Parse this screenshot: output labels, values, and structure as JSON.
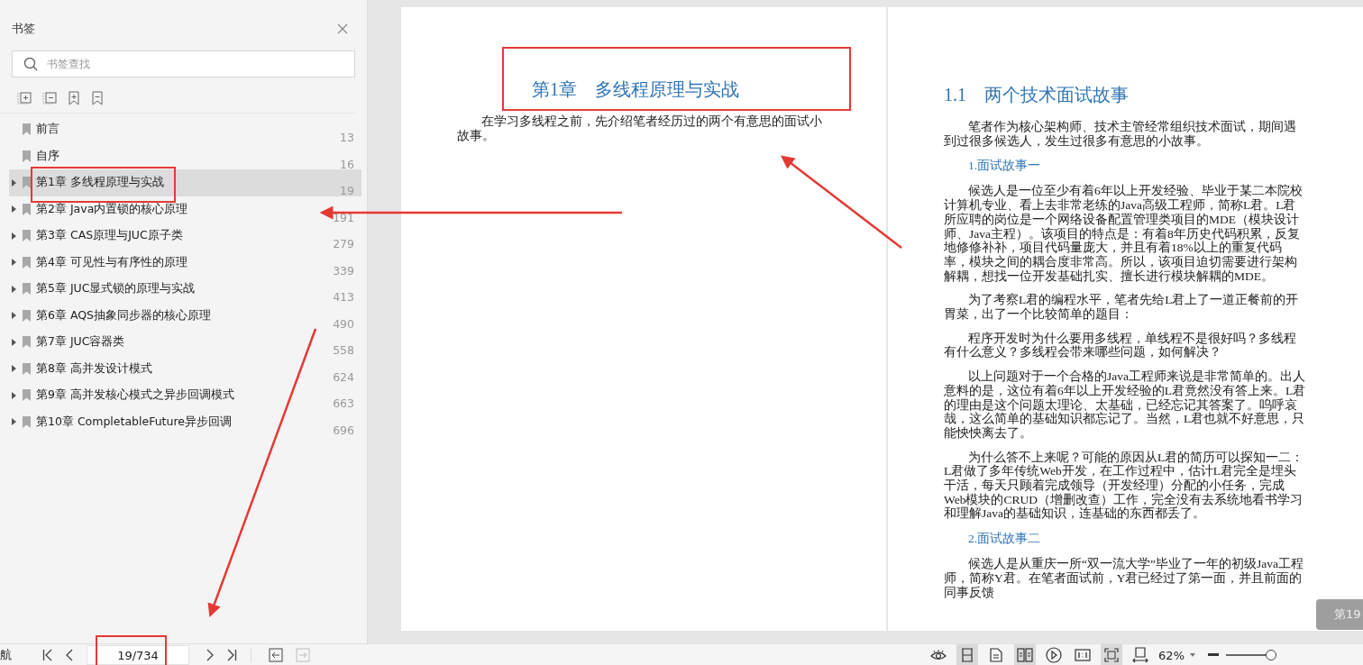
{
  "sidebar": {
    "title": "书签",
    "search": {
      "placeholder": "书签查找"
    },
    "items": [
      {
        "label": "前言",
        "page": "13",
        "collapsible": false,
        "selected": false
      },
      {
        "label": "自序",
        "page": "16",
        "collapsible": false,
        "selected": false
      },
      {
        "label": "第1章 多线程原理与实战",
        "page": "19",
        "collapsible": true,
        "selected": true
      },
      {
        "label": "第2章 Java内置锁的核心原理",
        "page": "191",
        "collapsible": true,
        "selected": false
      },
      {
        "label": "第3章 CAS原理与JUC原子类",
        "page": "279",
        "collapsible": true,
        "selected": false
      },
      {
        "label": "第4章 可见性与有序性的原理",
        "page": "339",
        "collapsible": true,
        "selected": false
      },
      {
        "label": "第5章 JUC显式锁的原理与实战",
        "page": "413",
        "collapsible": true,
        "selected": false
      },
      {
        "label": "第6章 AQS抽象同步器的核心原理",
        "page": "490",
        "collapsible": true,
        "selected": false
      },
      {
        "label": "第7章 JUC容器类",
        "page": "558",
        "collapsible": true,
        "selected": false
      },
      {
        "label": "第8章 高并发设计模式",
        "page": "624",
        "collapsible": true,
        "selected": false
      },
      {
        "label": "第9章 高并发核心模式之异步回调模式",
        "page": "663",
        "collapsible": true,
        "selected": false
      },
      {
        "label": "第10章 CompletableFuture异步回调",
        "page": "696",
        "collapsible": true,
        "selected": false
      }
    ]
  },
  "left_page": {
    "title": "第1章　多线程原理与实战",
    "paragraph": "在学习多线程之前，先介绍笔者经历过的两个有意思的面试小故事。"
  },
  "right_page": {
    "heading": "1.1　两个技术面试故事",
    "blocks": [
      {
        "kind": "paragraph",
        "text": "笔者作为核心架构师、技术主管经常组织技术面试，期间遇到过很多候选人，发生过很多有意思的小故事。"
      },
      {
        "kind": "subheading",
        "text": "1.面试故事一"
      },
      {
        "kind": "paragraph",
        "text": "候选人是一位至少有着6年以上开发经验、毕业于某二本院校计算机专业、看上去非常老练的Java高级工程师，简称L君。L君所应聘的岗位是一个网络设备配置管理类项目的MDE（模块设计师、Java主程）。该项目的特点是：有着8年历史代码积累，反复地修修补补，项目代码量庞大，并且有着18%以上的重复代码率，模块之间的耦合度非常高。所以，该项目迫切需要进行架构解耦，想找一位开发基础扎实、擅长进行模块解耦的MDE。"
      },
      {
        "kind": "paragraph",
        "text": "为了考察L君的编程水平，笔者先给L君上了一道正餐前的开胃菜，出了一个比较简单的题目："
      },
      {
        "kind": "paragraph",
        "text": "程序开发时为什么要用多线程，单线程不是很好吗？多线程有什么意义？多线程会带来哪些问题，如何解决？"
      },
      {
        "kind": "paragraph",
        "text": "以上问题对于一个合格的Java工程师来说是非常简单的。出人意料的是，这位有着6年以上开发经验的L君竟然没有答上来。L君的理由是这个问题太理论、太基础，已经忘记其答案了。呜呼哀哉，这么简单的基础知识都忘记了。当然，L君也就不好意思，只能怏怏离去了。"
      },
      {
        "kind": "paragraph",
        "text": "为什么答不上来呢？可能的原因从L君的简历可以探知一二：L君做了多年传统Web开发，在工作过程中，估计L君完全是埋头干活，每天只顾着完成领导（开发经理）分配的小任务，完成Web模块的CRUD（增删改查）工作，完全没有去系统地看书学习和理解Java的基础知识，连基础的东西都丢了。"
      },
      {
        "kind": "subheading",
        "text": "2.面试故事二"
      },
      {
        "kind": "paragraph",
        "text": "候选人是从重庆一所“双一流大学”毕业了一年的初级Java工程师，简称Y君。在笔者面试前，Y君已经过了第一面，并且前面的同事反馈"
      }
    ]
  },
  "page_tab": "第19",
  "status_bar": {
    "nav_label": "航",
    "page_field": "19/734",
    "zoom": "62%",
    "zoom_slider": {
      "level": 0.9
    },
    "tools": [
      {
        "kind": "eye",
        "selected": false
      },
      {
        "kind": "continuous",
        "selected": true
      },
      {
        "kind": "single",
        "selected": false
      },
      {
        "kind": "double",
        "selected": true
      },
      {
        "kind": "play",
        "selected": false
      },
      {
        "kind": "actual",
        "selected": false
      },
      {
        "kind": "fit",
        "selected": true
      },
      {
        "kind": "width",
        "selected": false
      }
    ]
  }
}
